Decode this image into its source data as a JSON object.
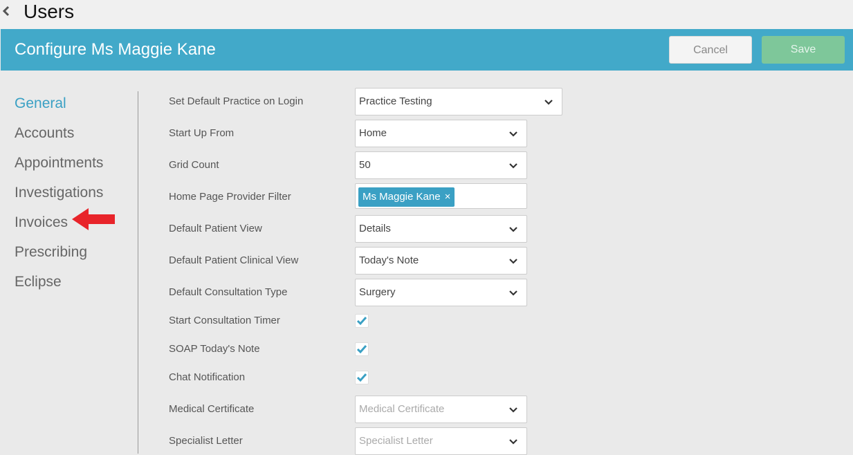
{
  "topbar": {
    "title": "Users"
  },
  "header": {
    "title": "Configure Ms Maggie Kane",
    "cancel_label": "Cancel",
    "save_label": "Save"
  },
  "sidebar": {
    "items": [
      {
        "label": "General"
      },
      {
        "label": "Accounts"
      },
      {
        "label": "Appointments"
      },
      {
        "label": "Investigations"
      },
      {
        "label": "Invoices"
      },
      {
        "label": "Prescribing"
      },
      {
        "label": "Eclipse"
      }
    ]
  },
  "form": {
    "default_practice": {
      "label": "Set Default Practice on Login",
      "value": "Practice Testing"
    },
    "start_up_from": {
      "label": "Start Up From",
      "value": "Home"
    },
    "grid_count": {
      "label": "Grid Count",
      "value": "50"
    },
    "provider_filter": {
      "label": "Home Page Provider Filter",
      "tag": "Ms Maggie Kane",
      "tag_remove": "×"
    },
    "patient_view": {
      "label": "Default Patient View",
      "value": "Details"
    },
    "clinical_view": {
      "label": "Default Patient Clinical View",
      "value": "Today's Note"
    },
    "consultation_type": {
      "label": "Default Consultation Type",
      "value": "Surgery"
    },
    "consultation_timer": {
      "label": "Start Consultation Timer",
      "checked": true
    },
    "soap_note": {
      "label": "SOAP Today's Note",
      "checked": true
    },
    "chat_notification": {
      "label": "Chat Notification",
      "checked": true
    },
    "medical_certificate": {
      "label": "Medical Certificate",
      "placeholder": "Medical Certificate"
    },
    "specialist_letter": {
      "label": "Specialist Letter",
      "placeholder": "Specialist Letter"
    }
  },
  "colors": {
    "accent": "#42a9c9",
    "save": "#7ec79a",
    "arrow": "#e8242a"
  },
  "icons": {
    "back": "chevron-left-icon",
    "dropdown": "chevron-down-icon",
    "check": "check-icon",
    "pointer": "red-arrow-icon"
  }
}
